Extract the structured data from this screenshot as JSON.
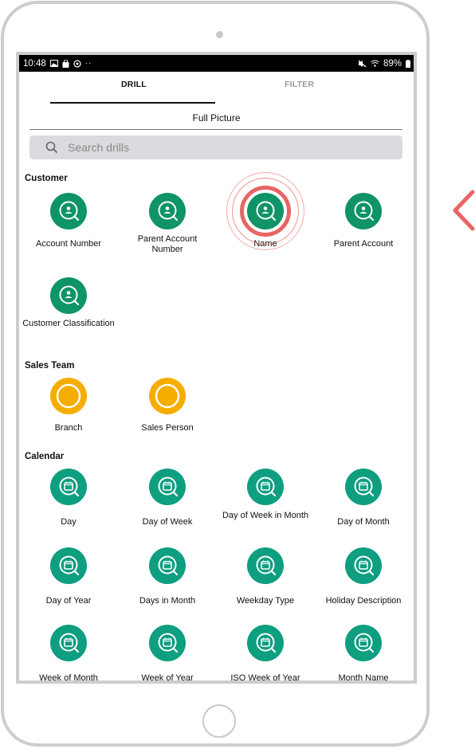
{
  "status_bar": {
    "time": "10:48",
    "left_icons": [
      "image-icon",
      "shopping-bag-icon",
      "sync-icon",
      "more-dots-icon"
    ],
    "right_icons": [
      "mute-icon",
      "wifi-icon"
    ],
    "battery": "89%"
  },
  "tabs": [
    {
      "label": "DRILL",
      "active": true
    },
    {
      "label": "FILTER",
      "active": false
    }
  ],
  "subtitle": "Full Picture",
  "search": {
    "placeholder": "Search drills",
    "value": ""
  },
  "colors": {
    "customer_green": "#0e9466",
    "calendar_teal": "#0e9e80",
    "sales_yellow": "#f5ad00",
    "highlight_red": "#e96565"
  },
  "sections": [
    {
      "title": "Customer",
      "icon": "person-search-icon",
      "items": [
        {
          "label": "Account Number"
        },
        {
          "label": "Parent Account Number"
        },
        {
          "label": "Name",
          "highlighted": true
        },
        {
          "label": "Parent Account"
        },
        {
          "label": "Customer Classification"
        }
      ]
    },
    {
      "title": "Sales Team",
      "icon": "ring-icon",
      "items": [
        {
          "label": "Branch"
        },
        {
          "label": "Sales Person"
        }
      ]
    },
    {
      "title": "Calendar",
      "icon": "calendar-search-icon",
      "items": [
        {
          "label": "Day"
        },
        {
          "label": "Day of Week"
        },
        {
          "label": "Day of Week in Month"
        },
        {
          "label": "Day of Month"
        },
        {
          "label": "Day of Year"
        },
        {
          "label": "Days in Month"
        },
        {
          "label": "Weekday Type"
        },
        {
          "label": "Holiday Description"
        },
        {
          "label": "Week of Month"
        },
        {
          "label": "Week of Year"
        },
        {
          "label": "ISO Week of Year"
        },
        {
          "label": "Month Name"
        }
      ]
    }
  ],
  "side_nav": {
    "icon": "chevron-left-icon"
  }
}
